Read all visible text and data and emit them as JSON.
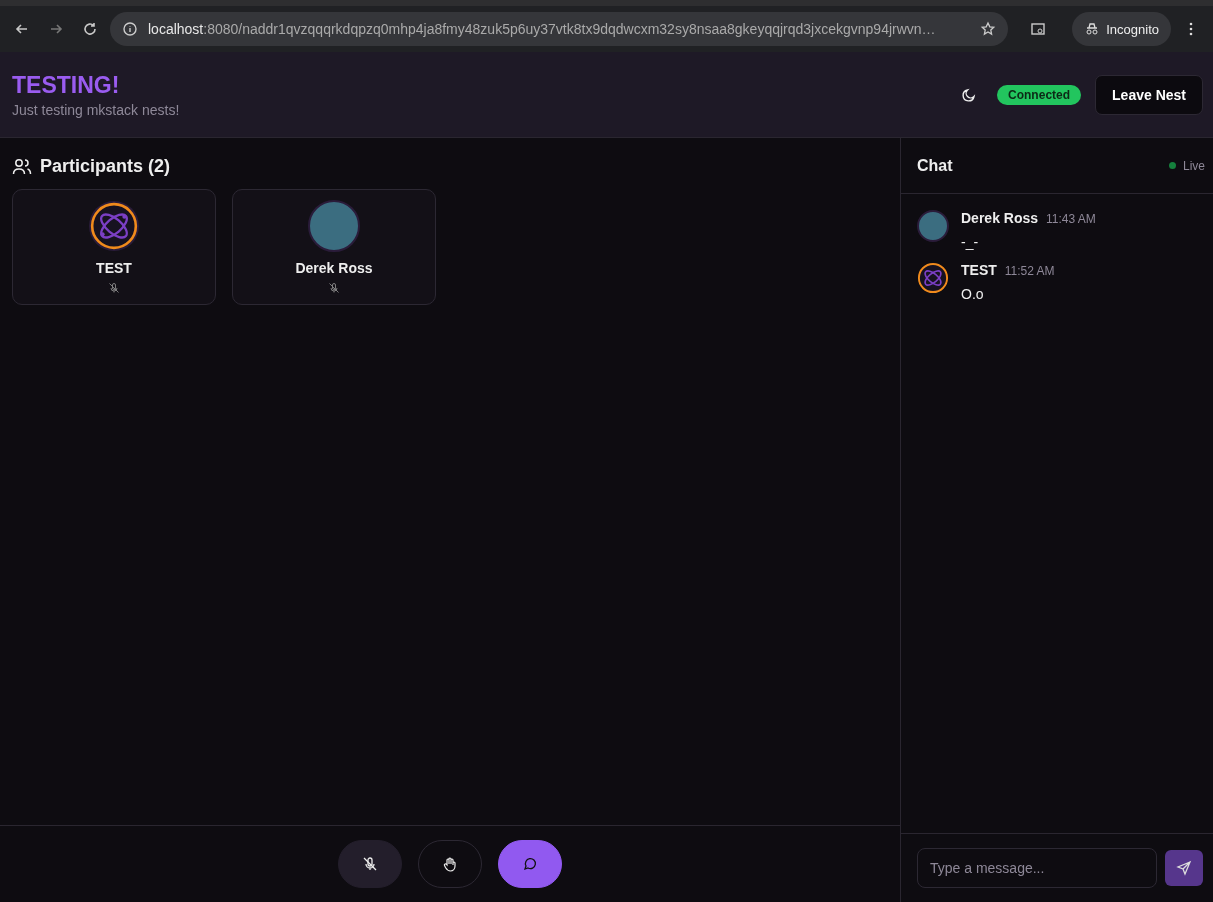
{
  "browser": {
    "url_host": "localhost",
    "url_rest": ":8080/naddr1qvzqqqrkdqpzq0mhp4ja8fmy48zuk5p6uy37vtk8tx9dqdwcxm32sy8nsaa8gkeyqqjrqd3jxcekgvnp94jrwvn…",
    "profile": "Incognito"
  },
  "header": {
    "title": "TESTING!",
    "subtitle": "Just testing mkstack nests!",
    "status": "Connected",
    "leave_button": "Leave Nest"
  },
  "participants": {
    "title": "Participants (2)",
    "items": [
      {
        "name": "TEST",
        "kind": "logo",
        "muted": true
      },
      {
        "name": "Derek Ross",
        "kind": "photo",
        "muted": true
      }
    ]
  },
  "controls": [
    {
      "kind": "mic",
      "selected": false
    },
    {
      "kind": "hand",
      "selected": false
    },
    {
      "kind": "chat",
      "selected": true
    }
  ],
  "chat": {
    "title": "Chat",
    "live": "Live",
    "messages": [
      {
        "author": "Derek Ross",
        "kind": "photo",
        "time": "11:43 AM",
        "text": "-_-"
      },
      {
        "author": "TEST",
        "kind": "logo",
        "time": "11:52 AM",
        "text": "O.o"
      }
    ],
    "input": {
      "placeholder": "Type a message..."
    }
  }
}
